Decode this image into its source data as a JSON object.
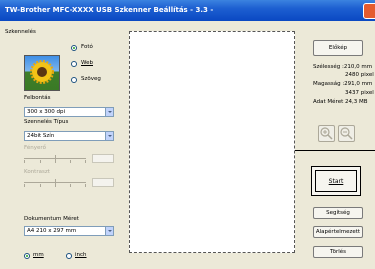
{
  "window": {
    "title": "TW-Brother  MFC-XXXX  USB Szkenner Beállítás - 3.3 -"
  },
  "left_panel": {
    "scanning_label": "Szkennelés",
    "scan_types": [
      {
        "label": "Fotó",
        "selected": true
      },
      {
        "label": "Web",
        "selected": false
      },
      {
        "label": "Szöveg",
        "selected": false
      }
    ],
    "resolution_label": "Felbontás",
    "resolution_value": "300 x 300 dpi",
    "scan_type_label": "Szennelés Típus",
    "scan_type_value": "24bit Szín",
    "brightness_label": "Fényerő",
    "contrast_label": "Kontraszt",
    "document_size_label": "Dokumentum Méret",
    "document_size_value": "A4 210 x 297 mm",
    "units": [
      {
        "label": "mm",
        "selected": true
      },
      {
        "label": "inch",
        "selected": false
      }
    ]
  },
  "right_panel": {
    "prescan_button": "Előkép",
    "width_label": "Szélesség :210,0 mm",
    "width_px": "2480 pixel",
    "height_label": "Magasság :291,0 mm",
    "height_px": "3437 pixel",
    "data_size": "Adat Méret  24,3 MB",
    "start_button": "Start",
    "help_button": "Segítség",
    "default_button": "Alapértelmezett",
    "cancel_button": "Törlés"
  },
  "colors": {
    "titlebar": "#0a48c2",
    "window_bg": "#ece9d8"
  }
}
